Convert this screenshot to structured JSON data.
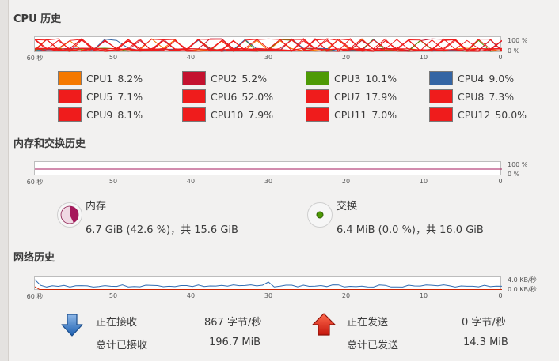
{
  "sections": {
    "cpu_title": "CPU 历史",
    "mem_title": "内存和交换历史",
    "net_title": "网络历史"
  },
  "axis": {
    "ticks": [
      "60 秒",
      "50",
      "40",
      "30",
      "20",
      "10",
      "0"
    ]
  },
  "cpu_graph": {
    "top_label": "100 %",
    "bottom_label": "0 %"
  },
  "mem_graph": {
    "top_label": "100 %",
    "bottom_label": "0 %"
  },
  "net_graph": {
    "top_label": "4.0 KB/秒",
    "bottom_label": "0.0 KB/秒"
  },
  "cpus": [
    {
      "name": "CPU1",
      "value": "8.2%",
      "color": "#f57900"
    },
    {
      "name": "CPU2",
      "value": "5.2%",
      "color": "#c4112f"
    },
    {
      "name": "CPU3",
      "value": "10.1%",
      "color": "#4e9a06"
    },
    {
      "name": "CPU4",
      "value": "9.0%",
      "color": "#3465a4"
    },
    {
      "name": "CPU5",
      "value": "7.1%",
      "color": "#ef1c1c"
    },
    {
      "name": "CPU6",
      "value": "52.0%",
      "color": "#ef1c1c"
    },
    {
      "name": "CPU7",
      "value": "17.9%",
      "color": "#ef1c1c"
    },
    {
      "name": "CPU8",
      "value": "7.3%",
      "color": "#ef1c1c"
    },
    {
      "name": "CPU9",
      "value": "8.1%",
      "color": "#ef1c1c"
    },
    {
      "name": "CPU10",
      "value": "7.9%",
      "color": "#ef1c1c"
    },
    {
      "name": "CPU11",
      "value": "7.0%",
      "color": "#ef1c1c"
    },
    {
      "name": "CPU12",
      "value": "50.0%",
      "color": "#ef1c1c"
    }
  ],
  "memory": {
    "label": "内存",
    "detail": "6.7 GiB (42.6 %)，共 15.6 GiB",
    "fraction": 0.426,
    "color": "#a6195c"
  },
  "swap": {
    "label": "交换",
    "detail": "6.4 MiB (0.0 %)，共 16.0 GiB",
    "fraction": 0.0,
    "color": "#4e9a06"
  },
  "network": {
    "receiving_label": "正在接收",
    "receiving_value": "867 字节/秒",
    "total_received_label": "总计已接收",
    "total_received_value": "196.7 MiB",
    "sending_label": "正在发送",
    "sending_value": "0 字节/秒",
    "total_sent_label": "总计已发送",
    "total_sent_value": "14.3 MiB"
  }
}
